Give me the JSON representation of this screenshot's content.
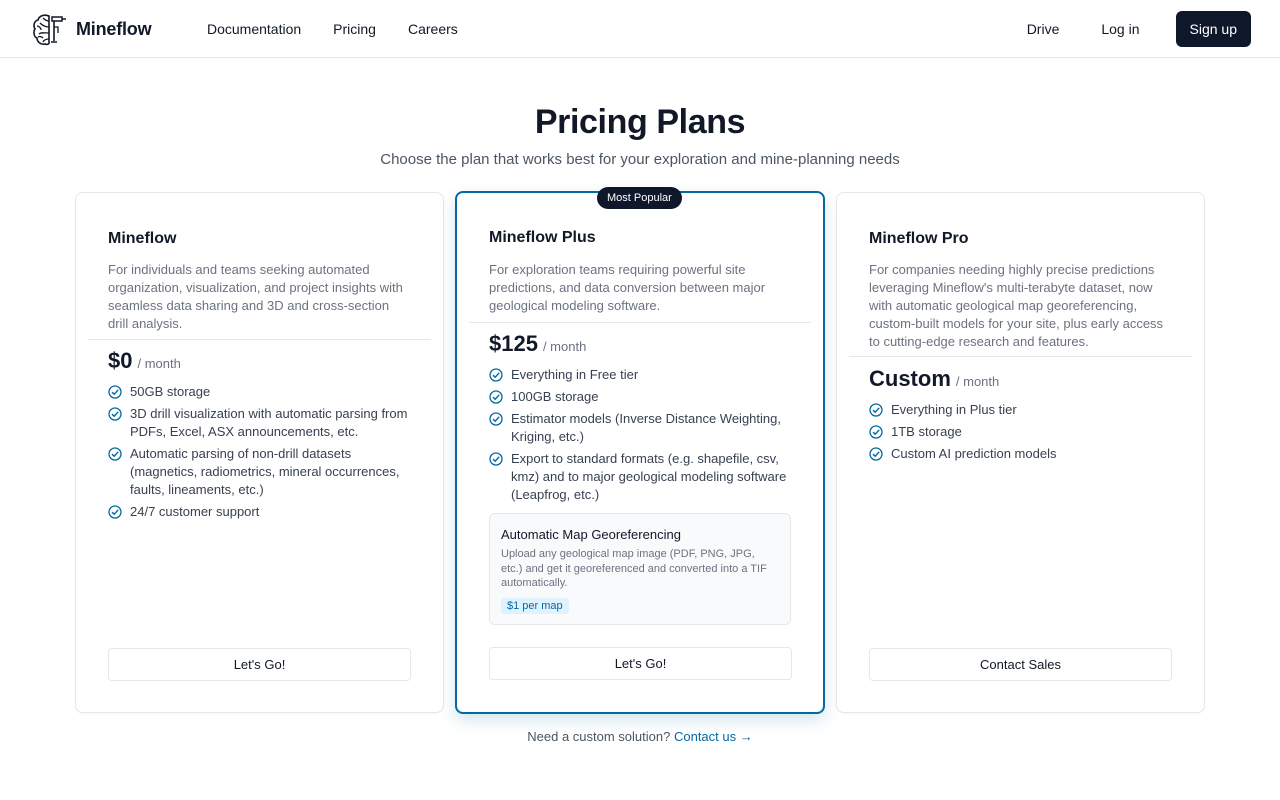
{
  "header": {
    "brand": "Mineflow",
    "nav": [
      "Documentation",
      "Pricing",
      "Careers"
    ],
    "drive": "Drive",
    "login": "Log in",
    "signup": "Sign up"
  },
  "hero": {
    "title": "Pricing Plans",
    "subtitle": "Choose the plan that works best for your exploration and mine-planning needs"
  },
  "plans": [
    {
      "name": "Mineflow",
      "description": "For individuals and teams seeking automated organization, visualization, and project insights with seamless data sharing and 3D and cross-section drill analysis.",
      "price": "$0",
      "period": "/ month",
      "features": [
        "50GB storage",
        "3D drill visualization with automatic parsing from PDFs, Excel, ASX announcements, etc.",
        "Automatic parsing of non-drill datasets (magnetics, radiometrics, mineral occurrences, faults, lineaments, etc.)",
        "24/7 customer support"
      ],
      "cta": "Let's Go!"
    },
    {
      "badge": "Most Popular",
      "name": "Mineflow Plus",
      "description": "For exploration teams requiring powerful site predictions, and data conversion between major geological modeling software.",
      "price": "$125",
      "period": "/ month",
      "features": [
        "Everything in Free tier",
        "100GB storage",
        "Estimator models (Inverse Distance Weighting, Kriging, etc.)",
        "Export to standard formats (e.g. shapefile, csv, kmz) and to major geological modeling software (Leapfrog, etc.)"
      ],
      "addon": {
        "title": "Automatic Map Georeferencing",
        "description": "Upload any geological map image (PDF, PNG, JPG, etc.) and get it georeferenced and converted into a TIF automatically.",
        "tag": "$1 per map"
      },
      "cta": "Let's Go!"
    },
    {
      "name": "Mineflow Pro",
      "description": "For companies needing highly precise predictions leveraging Mineflow's multi-terabyte dataset, now with automatic geological map georeferencing, custom-built models for your site, plus early access to cutting-edge research and features.",
      "price": "Custom",
      "period": "/ month",
      "features": [
        "Everything in Plus tier",
        "1TB storage",
        "Custom AI prediction models"
      ],
      "cta": "Contact Sales"
    }
  ],
  "footer": {
    "question": "Need a custom solution?",
    "link": "Contact us →"
  },
  "colors": {
    "accent": "#0369a1",
    "dark": "#0f172a",
    "muted": "#6b7280"
  }
}
